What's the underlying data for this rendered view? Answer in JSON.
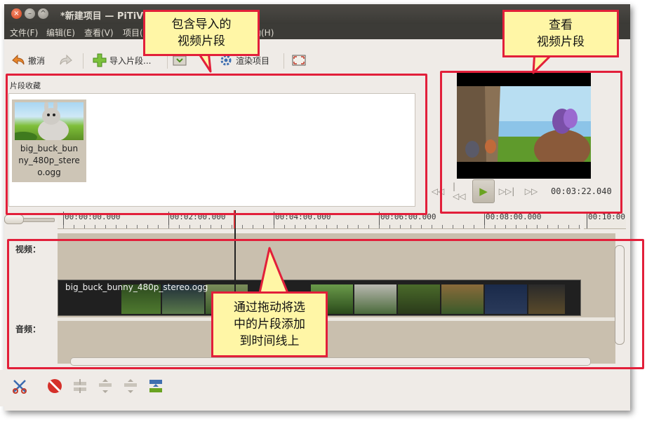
{
  "window": {
    "title": "*新建项目 — PiTiV",
    "controls": {
      "close": "×",
      "minimize": "–",
      "maximize": "^"
    }
  },
  "menu": [
    "文件(F)",
    "编辑(E)",
    "查看(V)",
    "项目(",
    "动(H)"
  ],
  "toolbar": {
    "undo": "撤消",
    "import": "导入片段...",
    "render": "渲染项目"
  },
  "bin": {
    "label": "片段收藏",
    "clips": [
      {
        "name": "big_buck_bun ny_480p_stere o.ogg",
        "lines": [
          "big_buck_bun",
          "ny_480p_stere",
          "o.ogg"
        ]
      }
    ]
  },
  "viewer": {
    "timecode": "00:03:22.040",
    "controls": [
      "skip-backward-icon",
      "rewind-icon",
      "play-icon",
      "forward-icon",
      "skip-forward-icon"
    ]
  },
  "ruler": {
    "labels": [
      "00:00:00.000",
      "00:02:00.000",
      "00:04:00.000",
      "00:06:00.000",
      "00:08:00.000",
      "00:10:00"
    ]
  },
  "timeline": {
    "video_label": "视频：",
    "audio_label": "音频：",
    "clip_title": "big_buck_bunny_480p_stereo.ogg"
  },
  "callouts": {
    "bin": [
      "包含导入的",
      "视频片段"
    ],
    "viewer": [
      "查看",
      "视频片段"
    ],
    "timeline": [
      "通过拖动将选",
      "中的片段添加",
      "到时间线上"
    ]
  },
  "colors": {
    "highlight": "#e21f3a",
    "callout_bg": "#fff6a6",
    "titlebar": "#3c3b37",
    "timeline_bg": "#c9bfae",
    "play_accent": "#6aa321"
  }
}
